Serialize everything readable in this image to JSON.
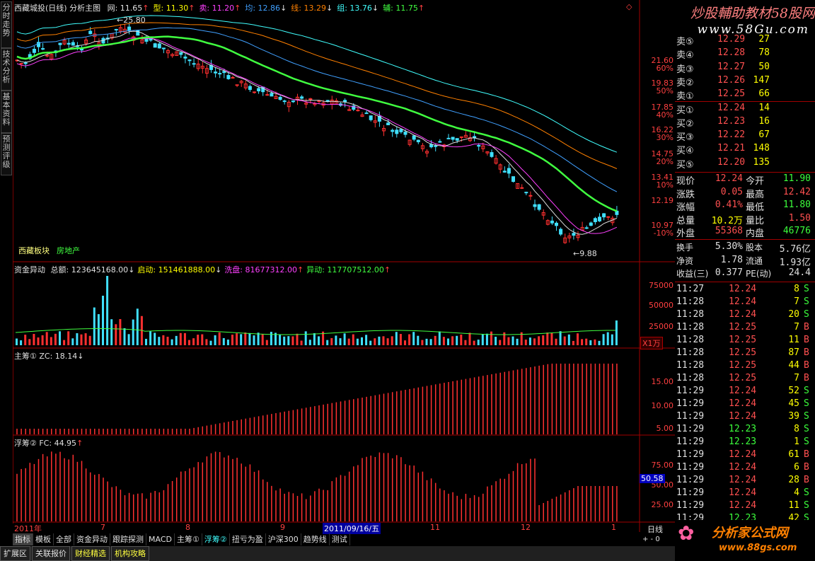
{
  "left_tabs": [
    "分时走势",
    "技术分析",
    "基本资料",
    "预测评级"
  ],
  "main_header": {
    "stock_name": "西藏城投(日线)",
    "panel": "分析主图",
    "items": [
      {
        "label": "网: 11.65",
        "arrow": "↑",
        "color": "#e0e0e0"
      },
      {
        "label": "型: 11.30",
        "arrow": "↑",
        "color": "#ffff00"
      },
      {
        "label": "卖: 11.20",
        "arrow": "↑",
        "color": "#ff40ff"
      },
      {
        "label": "均: 12.86",
        "arrow": "↓",
        "color": "#40a0ff"
      },
      {
        "label": "线: 13.29",
        "arrow": "↓",
        "color": "#ff8000"
      },
      {
        "label": "组: 13.76",
        "arrow": "↓",
        "color": "#40ffff"
      },
      {
        "label": "辅: 11.75",
        "arrow": "↑",
        "color": "#40ff40"
      }
    ]
  },
  "main_annotations": {
    "high_label": "25.80",
    "low_label": "9.88",
    "sector": "西藏板块",
    "industry": "房地产"
  },
  "price_axis": [
    {
      "value": "21.60",
      "pct": "60%"
    },
    {
      "value": "19.83",
      "pct": "50%"
    },
    {
      "value": "17.85",
      "pct": "40%"
    },
    {
      "value": "16.22",
      "pct": "30%"
    },
    {
      "value": "14.75",
      "pct": "20%"
    },
    {
      "value": "13.41",
      "pct": "10%"
    },
    {
      "value": "12.19",
      "pct": ""
    },
    {
      "value": "10.97",
      "pct": "-10%"
    }
  ],
  "volume_panel": {
    "title": "资金异动",
    "items": [
      {
        "label": "总额: 123645168.00",
        "arrow": "↓",
        "color": "#e0e0e0"
      },
      {
        "label": "启动: 151461888.00",
        "arrow": "↓",
        "color": "#ffff00"
      },
      {
        "label": "洗盘: 81677312.00",
        "arrow": "↑",
        "color": "#ff40ff"
      },
      {
        "label": "异动: 117707512.00",
        "arrow": "↑",
        "color": "#40ff40"
      }
    ],
    "axis": [
      "75000",
      "50000",
      "25000"
    ],
    "unit": "X1万"
  },
  "chip1_panel": {
    "title": "主筹① ZC: 18.14",
    "arrow": "↓",
    "axis": [
      "15.00",
      "10.00",
      "5.00"
    ]
  },
  "chip2_panel": {
    "title": "浮筹② FC: 44.95",
    "arrow": "↑",
    "axis": [
      "75.00",
      "50.00",
      "25.00"
    ],
    "highlight": "50.58"
  },
  "date_axis": [
    "2011年",
    "7",
    "8",
    "9",
    "2011/09/16/五",
    "11",
    "12",
    "1"
  ],
  "period": "日线",
  "bottom_tabs": [
    "指标",
    "模板",
    "全部",
    "资金异动",
    "跟踪探测",
    "MACD",
    "主筹①",
    "浮筹②",
    "扭亏为盈",
    "沪深300",
    "趋势线",
    "测试"
  ],
  "footer_tabs": [
    "扩展区",
    "关联报价",
    "财经精选",
    "机构攻略"
  ],
  "watermark_top": "炒股輔助教材58股网",
  "watermark_url": "www.58Gu.com",
  "watermark_bottom": "分析家公式网",
  "watermark_bottom_url": "www.88gs.com",
  "order_book": [
    {
      "label": "卖⑤",
      "price": "12.29",
      "vol": "27"
    },
    {
      "label": "卖④",
      "price": "12.28",
      "vol": "78"
    },
    {
      "label": "卖③",
      "price": "12.27",
      "vol": "50"
    },
    {
      "label": "卖②",
      "price": "12.26",
      "vol": "147"
    },
    {
      "label": "卖①",
      "price": "12.25",
      "vol": "66"
    },
    {
      "label": "买①",
      "price": "12.24",
      "vol": "14"
    },
    {
      "label": "买②",
      "price": "12.23",
      "vol": "16"
    },
    {
      "label": "买③",
      "price": "12.22",
      "vol": "67"
    },
    {
      "label": "买④",
      "price": "12.21",
      "vol": "148"
    },
    {
      "label": "买⑤",
      "price": "12.20",
      "vol": "135"
    }
  ],
  "quote": [
    {
      "l1": "现价",
      "v1": "12.24",
      "c1": "red",
      "l2": "今开",
      "v2": "11.90",
      "c2": "green"
    },
    {
      "l1": "涨跌",
      "v1": "0.05",
      "c1": "red",
      "l2": "最高",
      "v2": "12.42",
      "c2": "red"
    },
    {
      "l1": "涨幅",
      "v1": "0.41%",
      "c1": "red",
      "l2": "最低",
      "v2": "11.80",
      "c2": "green"
    },
    {
      "l1": "总量",
      "v1": "10.2万",
      "c1": "yellow",
      "l2": "量比",
      "v2": "1.50",
      "c2": "red"
    },
    {
      "l1": "外盘",
      "v1": "55368",
      "c1": "red",
      "l2": "内盘",
      "v2": "46776",
      "c2": "green"
    }
  ],
  "fundamentals": [
    {
      "l1": "换手",
      "v1": "5.30%",
      "l2": "股本",
      "v2": "5.76亿"
    },
    {
      "l1": "净资",
      "v1": "1.78",
      "l2": "流通",
      "v2": "1.93亿"
    },
    {
      "l1": "收益(三)",
      "v1": "0.377",
      "l2": "PE(动)",
      "v2": "24.4"
    }
  ],
  "ticks": [
    {
      "time": "11:27",
      "price": "12.24",
      "vol": "8",
      "side": "S"
    },
    {
      "time": "11:28",
      "price": "12.24",
      "vol": "7",
      "side": "S"
    },
    {
      "time": "11:28",
      "price": "12.24",
      "vol": "20",
      "side": "S"
    },
    {
      "time": "11:28",
      "price": "12.25",
      "vol": "7",
      "side": "B"
    },
    {
      "time": "11:28",
      "price": "12.25",
      "vol": "11",
      "side": "B"
    },
    {
      "time": "11:28",
      "price": "12.25",
      "vol": "87",
      "side": "B"
    },
    {
      "time": "11:28",
      "price": "12.25",
      "vol": "44",
      "side": "B"
    },
    {
      "time": "11:28",
      "price": "12.25",
      "vol": "7",
      "side": "B"
    },
    {
      "time": "11:29",
      "price": "12.24",
      "vol": "52",
      "side": "S"
    },
    {
      "time": "11:29",
      "price": "12.24",
      "vol": "45",
      "side": "S"
    },
    {
      "time": "11:29",
      "price": "12.24",
      "vol": "39",
      "side": "S"
    },
    {
      "time": "11:29",
      "price": "12.23",
      "vol": "8",
      "side": "S"
    },
    {
      "time": "11:29",
      "price": "12.23",
      "vol": "1",
      "side": "S"
    },
    {
      "time": "11:29",
      "price": "12.24",
      "vol": "61",
      "side": "B"
    },
    {
      "time": "11:29",
      "price": "12.24",
      "vol": "6",
      "side": "B"
    },
    {
      "time": "11:29",
      "price": "12.24",
      "vol": "28",
      "side": "B"
    },
    {
      "time": "11:29",
      "price": "12.24",
      "vol": "4",
      "side": "S"
    },
    {
      "time": "11:29",
      "price": "12.24",
      "vol": "11",
      "side": "S"
    },
    {
      "time": "11:29",
      "price": "12.23",
      "vol": "42",
      "side": "S"
    }
  ],
  "colors": {
    "up": "#ff3030",
    "down": "#40e0ff",
    "ma_green": "#40ff40",
    "grid": "#a00000"
  }
}
